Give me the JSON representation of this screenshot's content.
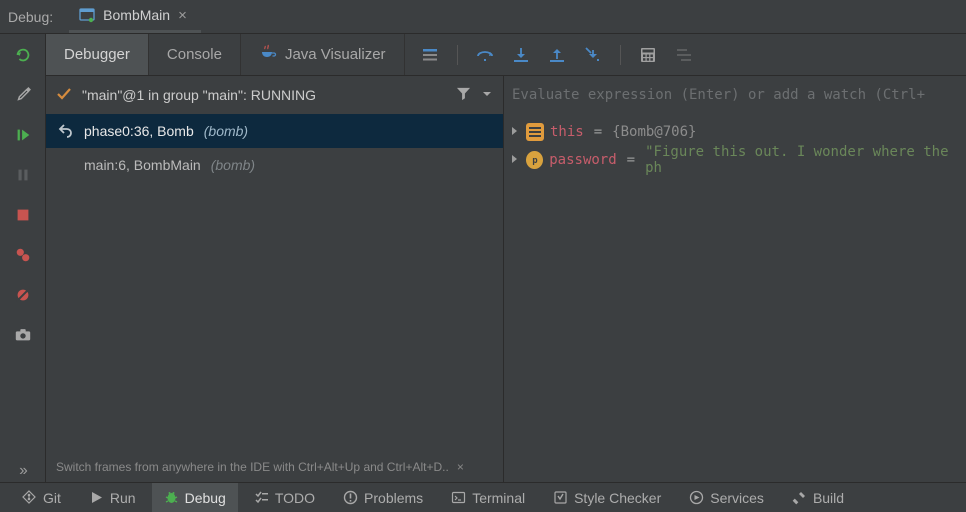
{
  "header": {
    "label": "Debug:",
    "session_name": "BombMain"
  },
  "tabs": {
    "debugger": "Debugger",
    "console": "Console",
    "visualizer": "Java Visualizer"
  },
  "frames": {
    "title": "\"main\"@1 in group \"main\": RUNNING",
    "rows": [
      {
        "text": "phase0:36, Bomb",
        "pkg": "(bomb)",
        "selected": true
      },
      {
        "text": "main:6, BombMain",
        "pkg": "(bomb)",
        "selected": false
      }
    ],
    "hint": "Switch frames from anywhere in the IDE with Ctrl+Alt+Up and Ctrl+Alt+D.."
  },
  "vars": {
    "placeholder": "Evaluate expression (Enter) or add a watch (Ctrl+",
    "items": [
      {
        "kind": "obj",
        "name": "this",
        "value": "{Bomb@706}"
      },
      {
        "kind": "prim",
        "name": "password",
        "value": "\"Figure this out. I wonder where the ph"
      }
    ]
  },
  "bottom": {
    "git": "Git",
    "run": "Run",
    "debug": "Debug",
    "todo": "TODO",
    "problems": "Problems",
    "terminal": "Terminal",
    "style": "Style Checker",
    "services": "Services",
    "build": "Build"
  }
}
